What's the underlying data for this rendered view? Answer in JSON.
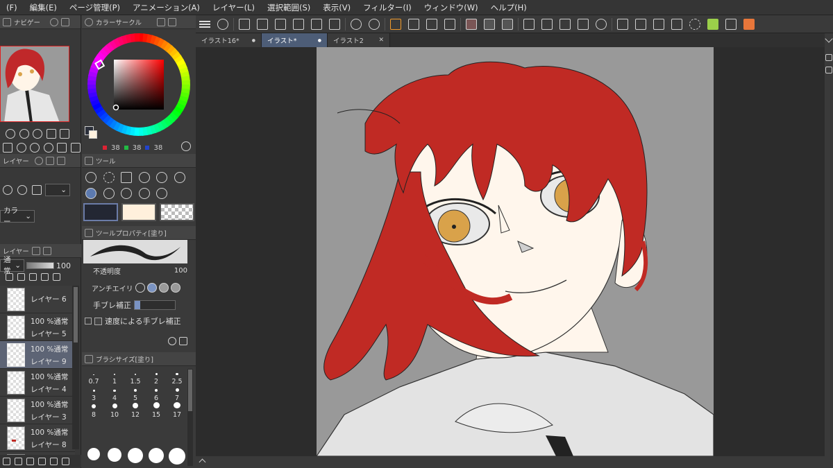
{
  "menubar": {
    "items": [
      "(F)",
      "編集(E)",
      "ページ管理(P)",
      "アニメーション(A)",
      "レイヤー(L)",
      "選択範囲(S)",
      "表示(V)",
      "フィルター(I)",
      "ウィンドウ(W)",
      "ヘルプ(H)"
    ]
  },
  "navigator": {
    "tab_label": "ナビゲー"
  },
  "color_panel": {
    "tab_label": "カラーサークル",
    "rgb": [
      "38",
      "38",
      "38"
    ],
    "colors": {
      "main": "#2b2f3a",
      "sub": "#fff2df"
    }
  },
  "layer_property": {
    "color_select": "カラー"
  },
  "layer_panel": {
    "tab_label": "レイヤー",
    "blend_mode": "通常",
    "opacity": "100",
    "layers": [
      {
        "blend": "",
        "name": "レイヤー 6",
        "selected": false
      },
      {
        "blend": "100 %通常",
        "name": "レイヤー 5",
        "selected": false
      },
      {
        "blend": "100 %通常",
        "name": "レイヤー 9",
        "selected": true
      },
      {
        "blend": "100 %通常",
        "name": "レイヤー 4",
        "selected": false
      },
      {
        "blend": "100 %通常",
        "name": "レイヤー 3",
        "selected": false
      },
      {
        "blend": "100 %通常",
        "name": "レイヤー 8",
        "selected": false
      },
      {
        "blend": "100 %通常",
        "name": "",
        "selected": false
      }
    ]
  },
  "tool_panel": {
    "tab_label": "ツール",
    "swatches": [
      "#232733",
      "#fff0dc",
      "checker"
    ]
  },
  "tool_property": {
    "tab_label": "ツールプロパティ[塗り]",
    "opacity_label": "不透明度",
    "opacity_value": "100",
    "antialias_label": "アンチエイリ",
    "stabilization_label": "手ブレ補正",
    "speed_stabilization_label": "速度による手ブレ補正"
  },
  "brush_size": {
    "tab_label": "ブラシサイズ[塗り]",
    "sizes": [
      "0.7",
      "1",
      "1.5",
      "2",
      "2.5",
      "3",
      "4",
      "5",
      "6",
      "7",
      "8",
      "10",
      "12",
      "15",
      "17"
    ]
  },
  "tabs": [
    {
      "label": "イラスト16*",
      "active": false
    },
    {
      "label": "イラスト*",
      "active": true
    },
    {
      "label": "イラスト2",
      "active": false
    }
  ],
  "canvas": {
    "background": "#999999",
    "colors": {
      "hair": "#c02a24",
      "skin": "#fff6ec",
      "iris": "#d9a24a",
      "shirt": "#e0e0e0",
      "line": "#333333"
    }
  }
}
